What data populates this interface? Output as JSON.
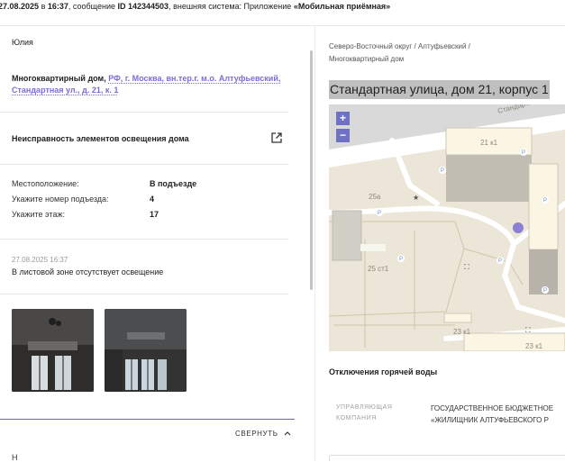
{
  "header": {
    "date": "27.08.2025",
    "in": "в",
    "time": "16:37",
    "msg_prefix": ", сообщение",
    "id_label": "ID",
    "id": "142344503",
    "ext_prefix": ", внешняя система: Приложение",
    "ext_system": "«Мобильная приёмная»"
  },
  "left": {
    "author": "Юлия",
    "building_type": "Многоквартирный дом,",
    "address_link": "РФ, г. Москва, вн.тер.г. м.о. Алтуфьевский, Стандартная ул., д. 21, к. 1",
    "issue_title": "Неисправность элементов освещения дома",
    "details": [
      {
        "key": "Местоположение:",
        "value": "В подъезде"
      },
      {
        "key": "Укажите номер подъезда:",
        "value": "4"
      },
      {
        "key": "Укажите этаж:",
        "value": "17"
      }
    ],
    "comment_date": "27.08.2025 16:37",
    "comment_text": "В листовой зоне отсутствует освещение",
    "collapse_label": "СВЕРНУТЬ",
    "next_label_partial": "Н"
  },
  "right": {
    "breadcrumb": "Северо-Восточный округ / Алтуфьевский / Многоквартирный дом",
    "address_title": "Стандартная улица, дом 21, корпус 1",
    "map": {
      "zoom_in": "+",
      "zoom_out": "−",
      "street_label": "Стандартн",
      "labels": [
        "21 к1",
        "25а",
        "25 ст1",
        "23 к1",
        "23 к1"
      ],
      "marker_color": "#8b7fd6"
    },
    "hot_water_title": "Отключения горячей воды",
    "uk_label": "УПРАВЛЯЮЩАЯ КОМПАНИЯ",
    "uk_value_line1": "ГОСУДАРСТВЕННОЕ БЮДЖЕТНОЕ",
    "uk_value_line2": "«ЖИЛИЩНИК АЛТУФЬЕВСКОГО Р"
  },
  "colors": {
    "accent": "#7a6fd1",
    "zoom_button": "#6f72c4",
    "title_highlight": "#bfbfbf"
  }
}
